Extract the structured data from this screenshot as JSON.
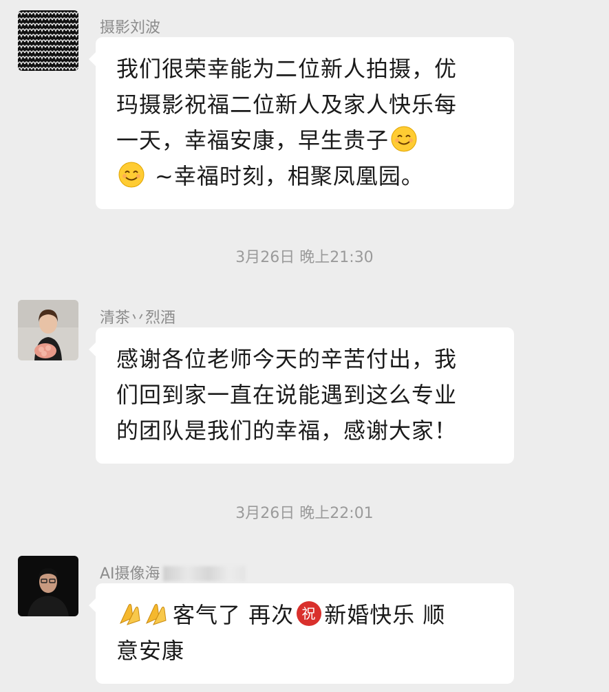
{
  "messages": [
    {
      "sender": "摄影刘波",
      "text_lines": [
        "我们很荣幸能为二位新人拍摄，优",
        "玛摄影祝福二位新人及家人快乐每",
        "一天，幸福安康，早生贵子",
        "~幸福时刻，相聚凤凰园。"
      ]
    },
    {
      "timestamp": "3月26日 晚上21:30",
      "sender": "清茶丷烈酒",
      "text_lines": [
        "感谢各位老师今天的辛苦付出，我",
        "们回到家一直在说能遇到这么专业",
        "的团队是我们的幸福，感谢大家！"
      ]
    },
    {
      "timestamp": "3月26日 晚上22:01",
      "sender": "AI摄像海",
      "text_parts": [
        "客气了 再次",
        "新婚快乐 顺"
      ],
      "text_line2": "意安康"
    }
  ],
  "icons": {
    "smile": "smiling-face-emoji",
    "pray": "folded-hands-emoji",
    "blessing": "congratulations-emoji"
  },
  "colors": {
    "background": "#ededed",
    "bubble": "#ffffff",
    "sender": "#8c8c8c",
    "timestamp": "#9a9a9a",
    "blessing_red": "#d9302c"
  }
}
